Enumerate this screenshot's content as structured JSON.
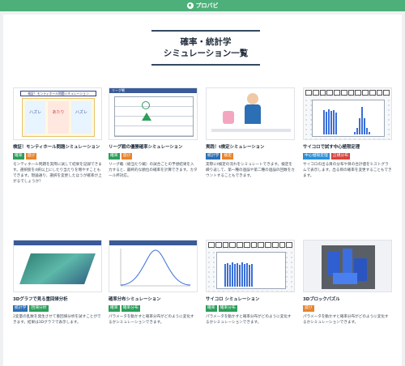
{
  "topbar": {
    "brand": "プロバビ"
  },
  "header": {
    "title_line1": "確率・統計学",
    "title_line2": "シミュレーション一覧"
  },
  "thumbs": {
    "monty_banner": "検証！モンティホール問題シミュレーション",
    "monty_doors": [
      "ハズレ",
      "あたり",
      "ハズレ"
    ],
    "liga_header": "リーグ戦"
  },
  "cards": [
    {
      "title": "検証！モンティホール問題シミュレーション",
      "tags": [
        "確率",
        "遊び"
      ],
      "desc": "モンティホール問題を実際に試して結果を記録できます。選択肢を4択以上にしたり当たりを増やすこともできます。現論通り、選択を変更したほうが確率が上がるでしょうか？"
    },
    {
      "title": "リーグ戦の優勝確率シミュレーション",
      "tags": [
        "確率",
        "遊び"
      ],
      "desc": "リーグ戦（総当たり戦）の試合ごとの予想結果を入力すると、最終的な順位の確率を計算できます。カタール杯対応。"
    },
    {
      "title": "実践！t検定シミュレーション",
      "tags": [
        "統計学",
        "検定"
      ],
      "desc": "実際にt検定の流れをシミュレートできます。検定を繰り返して、第一種の過誤や第二種の過誤の回数をカウントすることもできます。"
    },
    {
      "title": "サイコロで試す中心極限定理",
      "tags": [
        "中心極限定理",
        "正規分布"
      ],
      "desc": "サイコロの出る目の分布や目の合計値をヒストグラムで表示します。出る目の確率を変更することもできます。"
    },
    {
      "title": "3Dグラフで見る重回帰分析",
      "tags": [
        "統計学",
        "回帰分析"
      ],
      "desc": "2変量の乱数を発生させて重回帰分析を試すことができます。結果は3Dグラフで表示します。"
    },
    {
      "title": "確率分布シミュレーション",
      "tags": [
        "確率",
        "確率分布"
      ],
      "desc": "パラメータを動かすと確率分布がどのように変化するかシミュレーションできます。"
    },
    {
      "title": "サイコロ シミュレーション",
      "tags": [
        "確率",
        "確率分布"
      ],
      "desc": "パラメータを動かすと確率分布がどのように変化するかシミュレーションできます。"
    },
    {
      "title": "3Dブロックパズル",
      "tags": [
        "遊び"
      ],
      "desc": "パラメータを動かすと確率分布がどのように変化するかシミュレーションできます。"
    }
  ],
  "tag_colors": {
    "確率": "#2e9e5b",
    "遊び": "#e8842c",
    "統計学": "#2c6fb5",
    "検定": "#e8842c",
    "中心極限定理": "#2c8fd6",
    "正規分布": "#d6453d",
    "回帰分析": "#2e9e5b",
    "確率分布": "#2e9e5b"
  }
}
